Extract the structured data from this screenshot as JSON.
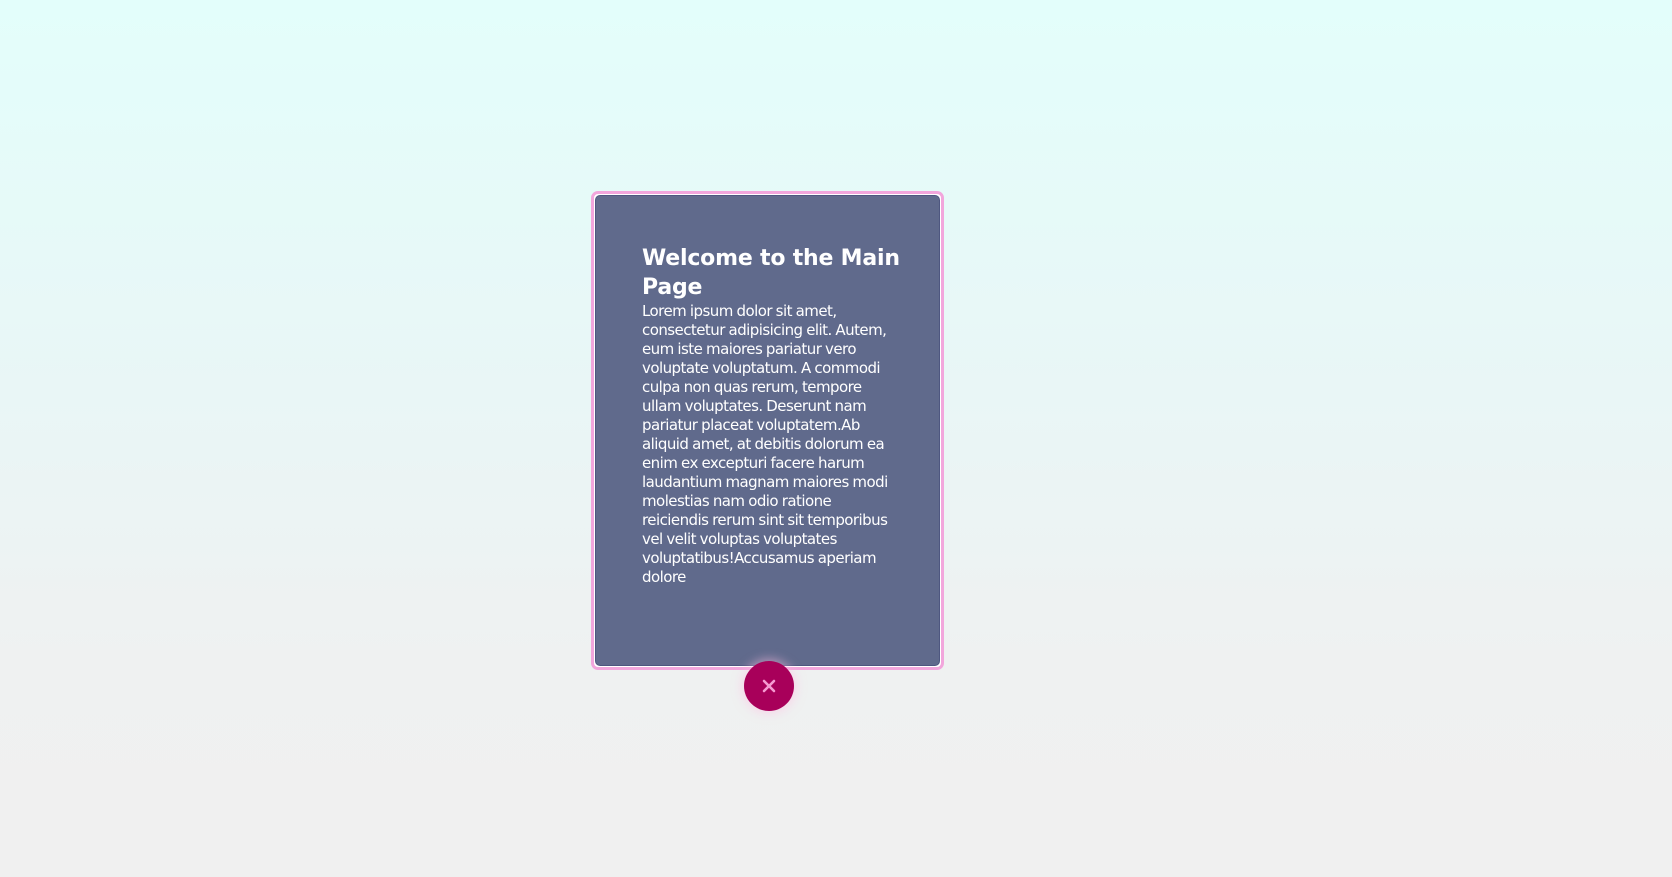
{
  "modal": {
    "title": "Welcome to the Main Page",
    "body": "Lorem ipsum dolor sit amet, consectetur adipisicing elit. Autem, eum iste maiores pariatur vero voluptate voluptatum. A commodi culpa non quas rerum, tempore ullam voluptates. Deserunt nam pariatur placeat voluptatem.Ab aliquid amet, at debitis dolorum ea enim ex excepturi facere harum laudantium magnam maiores modi molestias nam odio ratione reiciendis rerum sint sit temporibus vel velit voluptas voluptates voluptatibus!Accusamus aperiam dolore"
  },
  "close_button": {
    "icon": "close-icon"
  },
  "colors": {
    "page_background_top": "#e3fefb",
    "page_background_bottom": "#f0f0f0",
    "modal_border": "#f2a6dc",
    "modal_background": "#606a8c",
    "close_button_background": "#a8005a",
    "close_icon": "#f59ad1"
  }
}
